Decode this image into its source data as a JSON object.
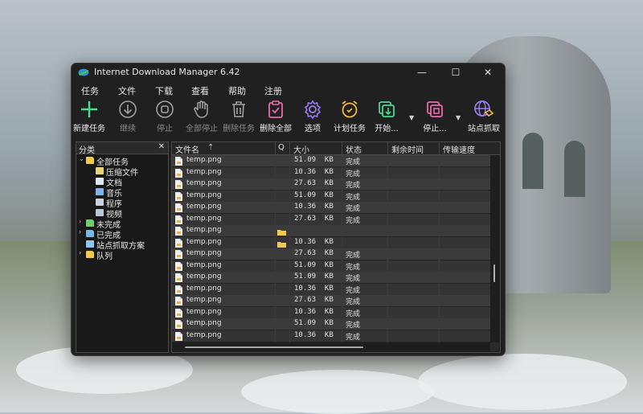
{
  "window": {
    "title": "Internet Download Manager 6.42"
  },
  "window_controls": {
    "minimize": "—",
    "maximize": "☐",
    "close": "✕"
  },
  "menu": [
    "任务",
    "文件",
    "下载",
    "查看",
    "帮助",
    "注册"
  ],
  "toolbar": [
    {
      "label": "新建任务",
      "icon": "add-icon",
      "enabled": true,
      "color": "#4ad991"
    },
    {
      "label": "继续",
      "icon": "resume-icon",
      "enabled": false,
      "color": "#9a9a9a"
    },
    {
      "label": "停止",
      "icon": "stop-icon",
      "enabled": false,
      "color": "#9a9a9a"
    },
    {
      "label": "全部停止",
      "icon": "hand-icon",
      "enabled": false,
      "color": "#9a9a9a"
    },
    {
      "label": "删除任务",
      "icon": "trash-icon",
      "enabled": false,
      "color": "#9a9a9a"
    },
    {
      "label": "删除全部",
      "icon": "clipboard-delete-icon",
      "enabled": true,
      "color": "#ea6aa8"
    },
    {
      "label": "选项",
      "icon": "gear-icon",
      "enabled": true,
      "color": "#9b7cf0"
    },
    {
      "label": "计划任务",
      "icon": "alarm-clock-icon",
      "enabled": true,
      "color": "#f3b74a"
    },
    {
      "label": "开始...",
      "icon": "queue-start-icon",
      "enabled": true,
      "color": "#4ad991"
    },
    {
      "label": "停止...",
      "icon": "queue-stop-icon",
      "enabled": true,
      "color": "#ea6aa8"
    },
    {
      "label": "站点抓取",
      "icon": "site-grabber-icon",
      "enabled": true,
      "color": "#9b7cf0"
    }
  ],
  "sidebar": {
    "title": "分类",
    "close": "✕",
    "tree": [
      {
        "label": "全部任务",
        "level": 0,
        "arrow": "⌄",
        "icon": "folder-open-icon"
      },
      {
        "label": "压缩文件",
        "level": 1,
        "icon": "zip-file-icon"
      },
      {
        "label": "文档",
        "level": 1,
        "icon": "document-icon"
      },
      {
        "label": "音乐",
        "level": 1,
        "icon": "music-icon"
      },
      {
        "label": "程序",
        "level": 1,
        "icon": "program-icon"
      },
      {
        "label": "视频",
        "level": 1,
        "icon": "video-icon"
      },
      {
        "label": "未完成",
        "level": 0,
        "arrow": "›",
        "icon": "unfinished-folder-icon"
      },
      {
        "label": "已完成",
        "level": 0,
        "arrow": "›",
        "icon": "finished-folder-icon"
      },
      {
        "label": "站点抓取方案",
        "level": 0,
        "arrow": "",
        "icon": "grabber-projects-icon"
      },
      {
        "label": "队列",
        "level": 0,
        "arrow": "›",
        "icon": "queue-folder-icon"
      }
    ]
  },
  "table": {
    "columns": [
      "文件名",
      "Q",
      "大小",
      "状态",
      "剩余时间",
      "传输速度"
    ],
    "sort_indicator": "⇡",
    "rows": [
      {
        "name": "temp.png",
        "q": false,
        "size": "51.09  KB",
        "status": "完成"
      },
      {
        "name": "temp.png",
        "q": false,
        "size": "10.36  KB",
        "status": "完成"
      },
      {
        "name": "temp.png",
        "q": false,
        "size": "27.63  KB",
        "status": "完成"
      },
      {
        "name": "temp.png",
        "q": false,
        "size": "51.09  KB",
        "status": "完成"
      },
      {
        "name": "temp.png",
        "q": false,
        "size": "10.36  KB",
        "status": "完成"
      },
      {
        "name": "temp.png",
        "q": false,
        "size": "27.63  KB",
        "status": "完成"
      },
      {
        "name": "temp.png",
        "q": true,
        "size": "",
        "status": ""
      },
      {
        "name": "temp.png",
        "q": true,
        "size": "10.36  KB",
        "status": ""
      },
      {
        "name": "temp.png",
        "q": false,
        "size": "27.63  KB",
        "status": "完成"
      },
      {
        "name": "temp.png",
        "q": false,
        "size": "51.09  KB",
        "status": "完成"
      },
      {
        "name": "temp.png",
        "q": false,
        "size": "51.09  KB",
        "status": "完成"
      },
      {
        "name": "temp.png",
        "q": false,
        "size": "10.36  KB",
        "status": "完成"
      },
      {
        "name": "temp.png",
        "q": false,
        "size": "27.63  KB",
        "status": "完成"
      },
      {
        "name": "temp.png",
        "q": false,
        "size": "10.36  KB",
        "status": "完成"
      },
      {
        "name": "temp.png",
        "q": false,
        "size": "51.09  KB",
        "status": "完成"
      },
      {
        "name": "temp.png",
        "q": false,
        "size": "10.36  KB",
        "status": "完成"
      }
    ]
  }
}
